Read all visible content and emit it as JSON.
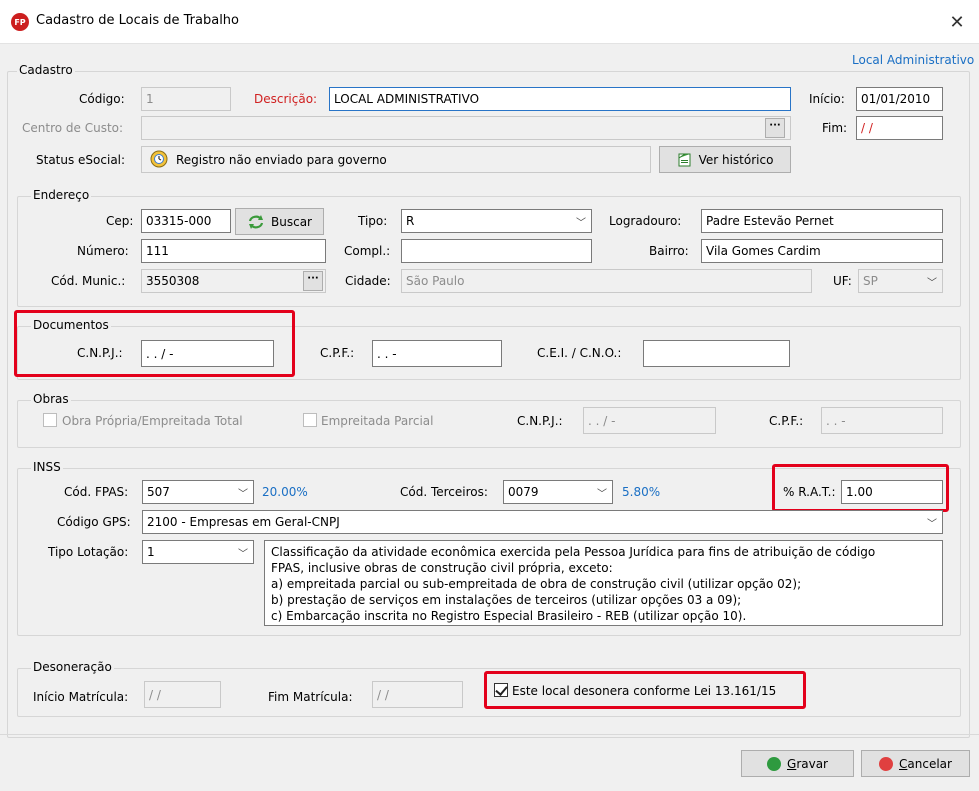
{
  "window": {
    "title": "Cadastro de Locais de Trabalho",
    "app_icon_text": "FP",
    "close_glyph": "✕"
  },
  "top_link": "Local Administrativo",
  "cadastro": {
    "group_label": "Cadastro",
    "codigo_label": "Código:",
    "codigo_value": "1",
    "descricao_label": "Descrição:",
    "descricao_value": "LOCAL ADMINISTRATIVO",
    "inicio_label": "Início:",
    "inicio_value": "01/01/2010",
    "centro_label": "Centro de Custo:",
    "centro_value": "",
    "fim_label": "Fim:",
    "fim_value": " / /",
    "status_label": "Status eSocial:",
    "status_value": "Registro não enviado para governo",
    "historico_button": "Ver histórico"
  },
  "endereco": {
    "group_label": "Endereço",
    "cep_label": "Cep:",
    "cep_value": "03315-000",
    "buscar_button": "Buscar",
    "tipo_label": "Tipo:",
    "tipo_value": "R",
    "logradouro_label": "Logradouro:",
    "logradouro_value": "Padre Estevão Pernet",
    "numero_label": "Número:",
    "numero_value": "111",
    "compl_label": "Compl.:",
    "compl_value": "",
    "bairro_label": "Bairro:",
    "bairro_value": "Vila Gomes Cardim",
    "codmunic_label": "Cód. Munic.:",
    "codmunic_value": "3550308",
    "cidade_label": "Cidade:",
    "cidade_value": "São Paulo",
    "uf_label": "UF:",
    "uf_value": "SP"
  },
  "documentos": {
    "group_label": "Documentos",
    "cnpj_label": "C.N.P.J.:",
    "cnpj_value": " .  .  /   -",
    "cpf_label": "C.P.F.:",
    "cpf_value": " .  .  -",
    "cei_label": "C.E.I. / C.N.O.:",
    "cei_value": ""
  },
  "obras": {
    "group_label": "Obras",
    "propria_label": "Obra Própria/Empreitada Total",
    "parcial_label": "Empreitada Parcial",
    "cnpj_label": "C.N.P.J.:",
    "cnpj_value": " .  .  /   -",
    "cpf_label": "C.P.F.:",
    "cpf_value": " .  .  -"
  },
  "inss": {
    "group_label": "INSS",
    "fpas_label": "Cód. FPAS:",
    "fpas_value": "507",
    "fpas_percent": "20.00%",
    "terceiros_label": "Cód. Terceiros:",
    "terceiros_value": "0079",
    "terceiros_percent": "5.80%",
    "rat_label": "% R.A.T.:",
    "rat_value": "1.00",
    "gps_label": "Código GPS:",
    "gps_value": "2100  - Empresas em Geral-CNPJ",
    "lotacao_label": "Tipo Lotação:",
    "lotacao_value": "1",
    "lotacao_desc": [
      "Classificação da atividade econômica exercida pela Pessoa Jurídica para fins de atribuição de código",
      "FPAS, inclusive obras de construção civil própria, exceto:",
      "a) empreitada parcial ou sub-empreitada de obra de construção civil (utilizar opção 02);",
      "b) prestação de serviços em instalações de terceiros (utilizar opções 03 a 09);",
      "c) Embarcação inscrita no Registro Especial Brasileiro - REB (utilizar opção 10)."
    ]
  },
  "desoneracao": {
    "group_label": "Desoneração",
    "inicio_label": "Início Matrícula:",
    "inicio_value": " / /",
    "fim_label": "Fim Matrícula:",
    "fim_value": " / /",
    "lei_label": "Este local desonera conforme Lei 13.161/15"
  },
  "footer": {
    "gravar_first": "G",
    "gravar_rest": "ravar",
    "cancelar_first": "C",
    "cancelar_rest": "ancelar"
  },
  "colors": {
    "accent_red": "#e3001b",
    "link_blue": "#1a6fc4",
    "label_red": "#d01f1f"
  }
}
